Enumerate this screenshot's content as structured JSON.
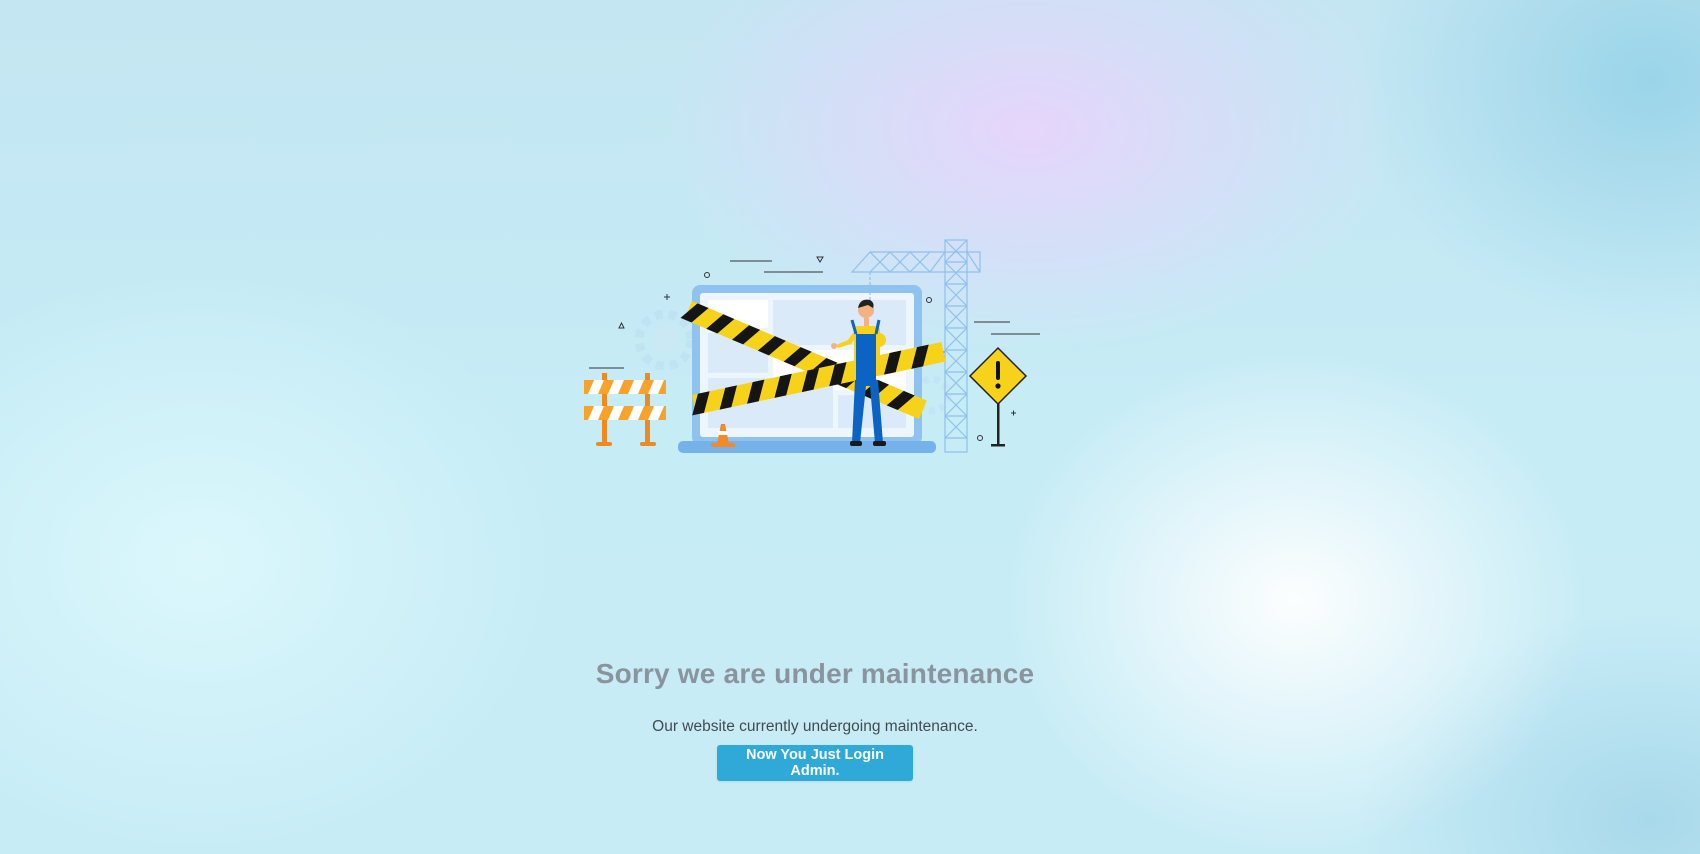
{
  "page": {
    "heading": "Sorry we are under maintenance",
    "description": "Our website currently undergoing maintenance.",
    "admin_login_button": "Now You Just Login Admin."
  },
  "colors": {
    "button": "#2ea9d8",
    "heading": "#8a949c",
    "tape_yellow": "#f6d21a",
    "worker_blue": "#0b63c4",
    "crane_blue": "#9cc8ee"
  },
  "illustration": {
    "icons": [
      "laptop-icon",
      "caution-tape-icon",
      "worker-icon",
      "crane-icon",
      "warning-sign-icon",
      "barrier-icon",
      "traffic-cone-icon",
      "gear-icon"
    ]
  }
}
